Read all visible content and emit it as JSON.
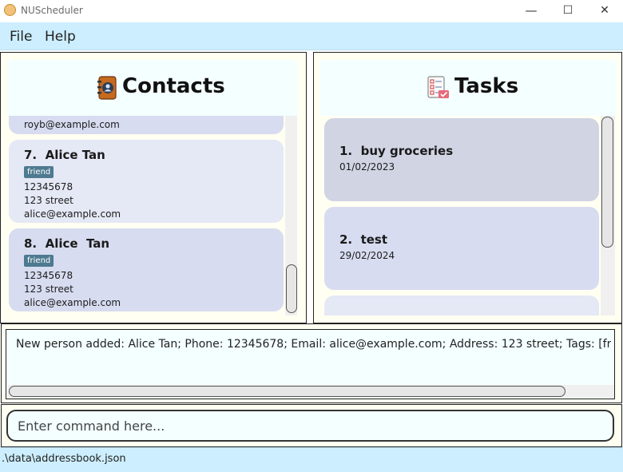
{
  "window": {
    "title": "NUScheduler",
    "minimize": "—",
    "maximize": "☐",
    "close": "✕"
  },
  "menu": {
    "file": "File",
    "help": "Help"
  },
  "contacts": {
    "title": "Contacts",
    "items": [
      {
        "name": "",
        "email": "royb@example.com"
      },
      {
        "name": "7.  Alice Tan",
        "tag": "friend",
        "phone": "12345678",
        "address": "123 street",
        "email": "alice@example.com"
      },
      {
        "name": "8.  Alice  Tan",
        "tag": "friend",
        "phone": "12345678",
        "address": "123 street",
        "email": "alice@example.com"
      }
    ]
  },
  "tasks": {
    "title": "Tasks",
    "items": [
      {
        "name": "1.  buy groceries",
        "date": "01/02/2023"
      },
      {
        "name": "2.  test",
        "date": "29/02/2024"
      }
    ]
  },
  "result": {
    "text": "New person added: Alice  Tan; Phone: 12345678; Email: alice@example.com; Address: 123 street; Tags: [friend]"
  },
  "command": {
    "placeholder": "Enter command here..."
  },
  "status": {
    "path": ".\\data\\addressbook.json"
  },
  "colors": {
    "menu_bg": "#cceeff",
    "pane_bg": "#fffff2",
    "card_bg_1": "#e5e8f5",
    "card_bg_2": "#d8dcf0",
    "task_bg_selected": "#d0d4e3",
    "tag_bg": "#4d7a90"
  },
  "icons": {
    "app": "app-logo-icon",
    "contacts": "address-book-icon",
    "tasks": "checklist-icon"
  }
}
